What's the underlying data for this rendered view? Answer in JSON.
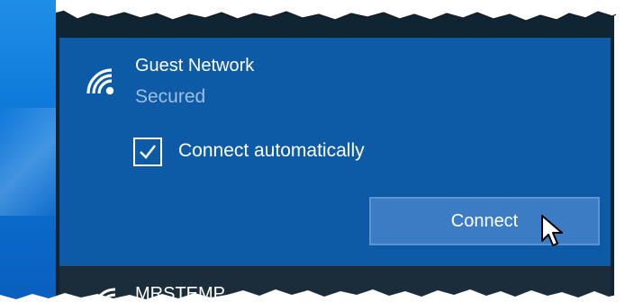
{
  "network": {
    "name": "Guest Network",
    "status": "Secured",
    "auto_connect_label": "Connect automatically",
    "auto_connect_checked": true,
    "connect_label": "Connect",
    "wifi_icon": "wifi-secured-icon"
  },
  "next_network": {
    "name": "MRSTEMP",
    "wifi_icon": "wifi-icon"
  },
  "colors": {
    "card": "#0d5aa7",
    "panel": "#0f2533",
    "button": "#3c7cc5",
    "status_text": "#9fbfe0"
  }
}
